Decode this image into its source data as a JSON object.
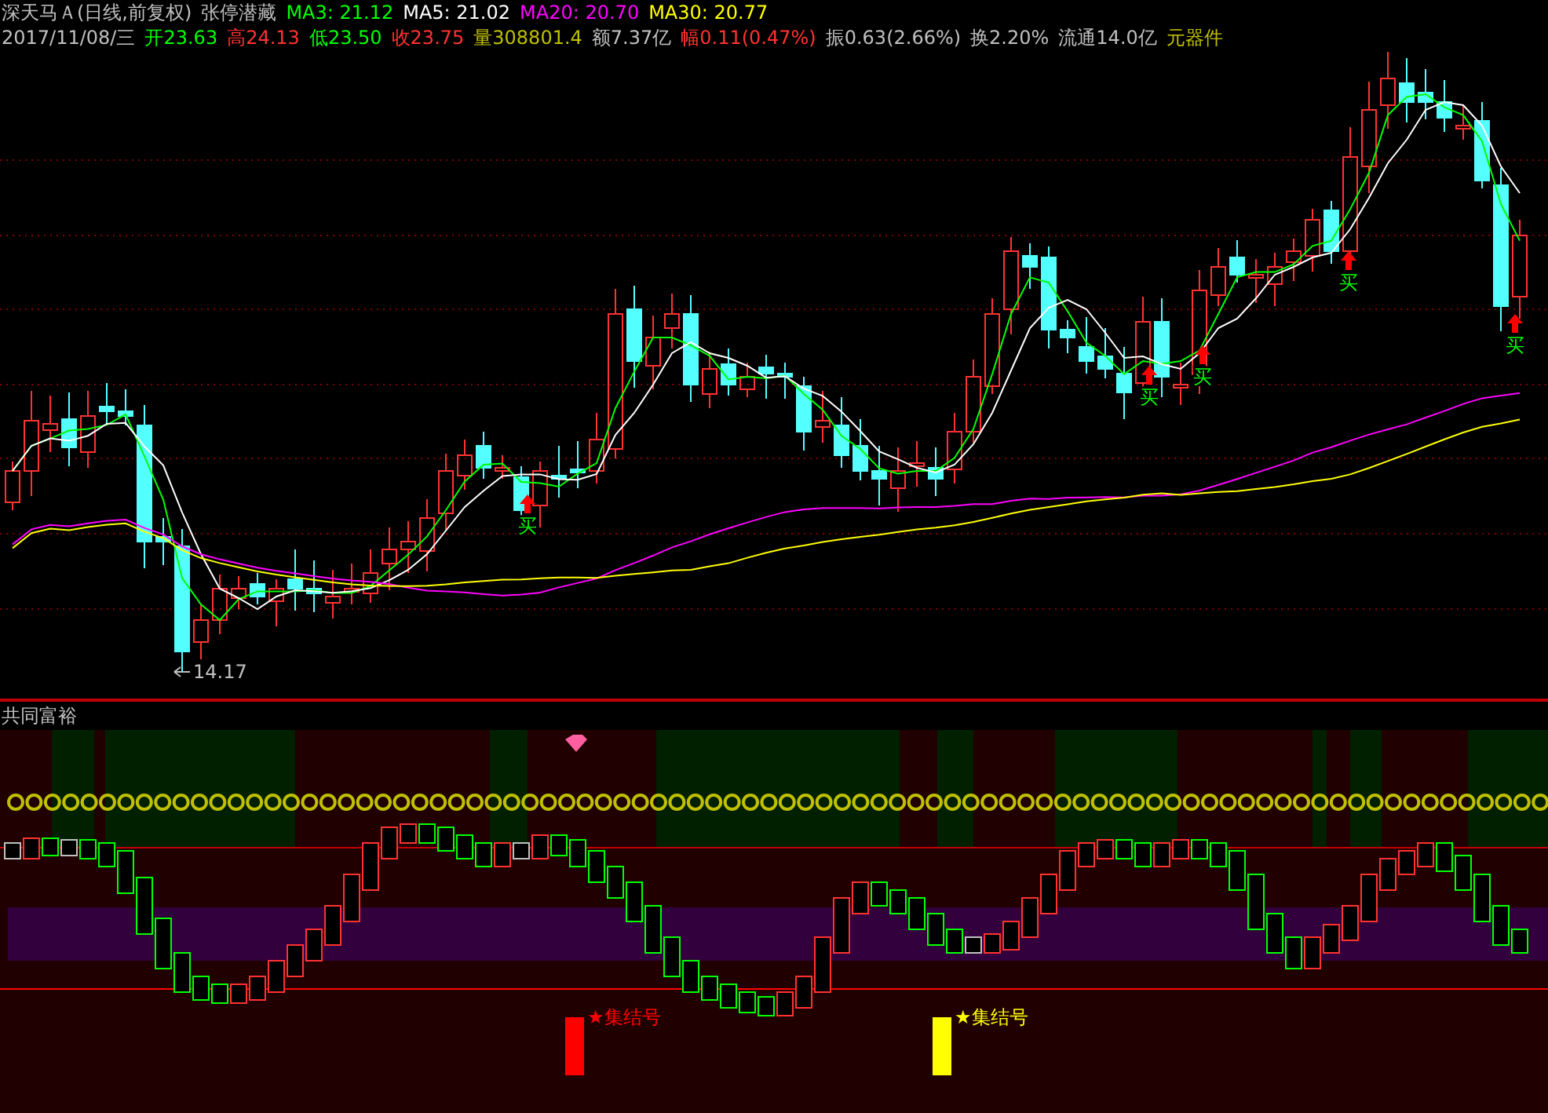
{
  "header": {
    "title": "深天马Ａ(日线,前复权)",
    "indicator": "张停潜藏",
    "ma": [
      {
        "label": "MA3: 21.12",
        "color": "#00ff00"
      },
      {
        "label": "MA5: 21.02",
        "color": "#ffffff"
      },
      {
        "label": "MA20: 20.70",
        "color": "#ff00ff"
      },
      {
        "label": "MA30: 20.77",
        "color": "#ffff00"
      }
    ]
  },
  "quote": [
    {
      "text": "2017/11/08/三",
      "color": "#c0c0c0"
    },
    {
      "text": "开23.63",
      "color": "#00ff00"
    },
    {
      "text": "高24.13",
      "color": "#ff3232"
    },
    {
      "text": "低23.50",
      "color": "#00ff00"
    },
    {
      "text": "收23.75",
      "color": "#ff3232"
    },
    {
      "text": "量308801.4",
      "color": "#c0c000"
    },
    {
      "text": "额7.37亿",
      "color": "#c0c0c0"
    },
    {
      "text": "幅0.11(0.47%)",
      "color": "#ff3232"
    },
    {
      "text": "振0.63(2.66%)",
      "color": "#c0c0c0"
    },
    {
      "text": "换2.20%",
      "color": "#c0c0c0"
    },
    {
      "text": "流通14.0亿",
      "color": "#c0c0c0"
    },
    {
      "text": "元器件",
      "color": "#c0c000"
    }
  ],
  "price_chart": {
    "low_marker": "14.17",
    "buy_signals": [
      {
        "label": "买"
      },
      {
        "label": "买"
      },
      {
        "label": "买"
      },
      {
        "label": "买"
      },
      {
        "label": "买"
      }
    ]
  },
  "sub_panel": {
    "title": "共同富裕",
    "signals": [
      {
        "label": "★集结号",
        "color": "#ff0000"
      },
      {
        "label": "★集结号",
        "color": "#ffff00"
      }
    ]
  }
}
